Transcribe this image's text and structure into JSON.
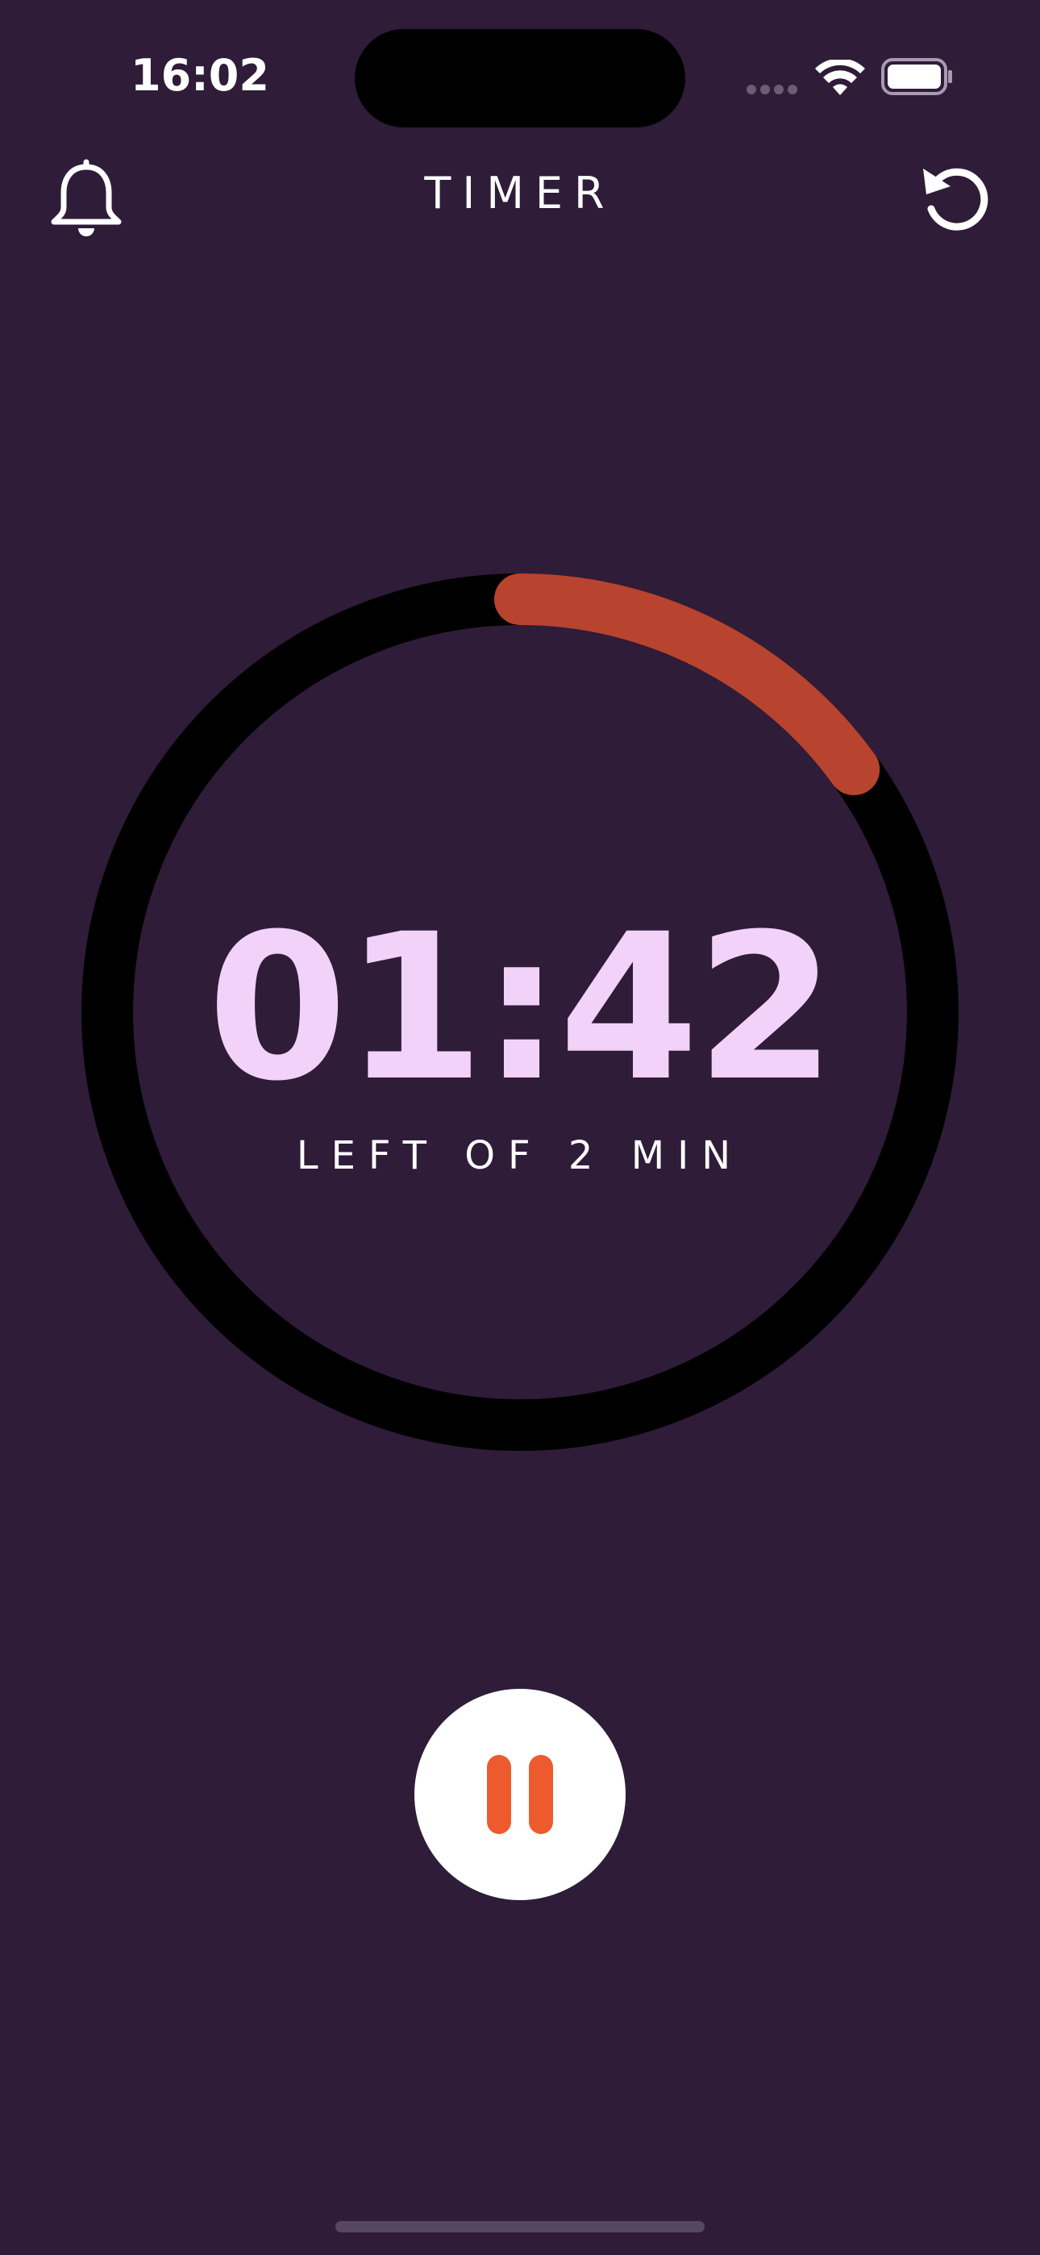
{
  "status_bar": {
    "time": "16:02"
  },
  "header": {
    "title": "TIMER"
  },
  "timer": {
    "display": "01:42",
    "caption": "LEFT OF 2 MIN",
    "progress_fraction": 0.15
  },
  "colors": {
    "background": "#2e1c38",
    "ring_track": "#000000",
    "ring_progress": "#b8432f",
    "time_text": "#f2d2f8",
    "pause_icon": "#ec5a2e"
  },
  "icons": {
    "bell": "bell-icon",
    "reset": "reset-icon",
    "pause": "pause-icon",
    "wifi": "wifi-icon",
    "battery": "battery-icon",
    "signal": "signal-icon"
  }
}
